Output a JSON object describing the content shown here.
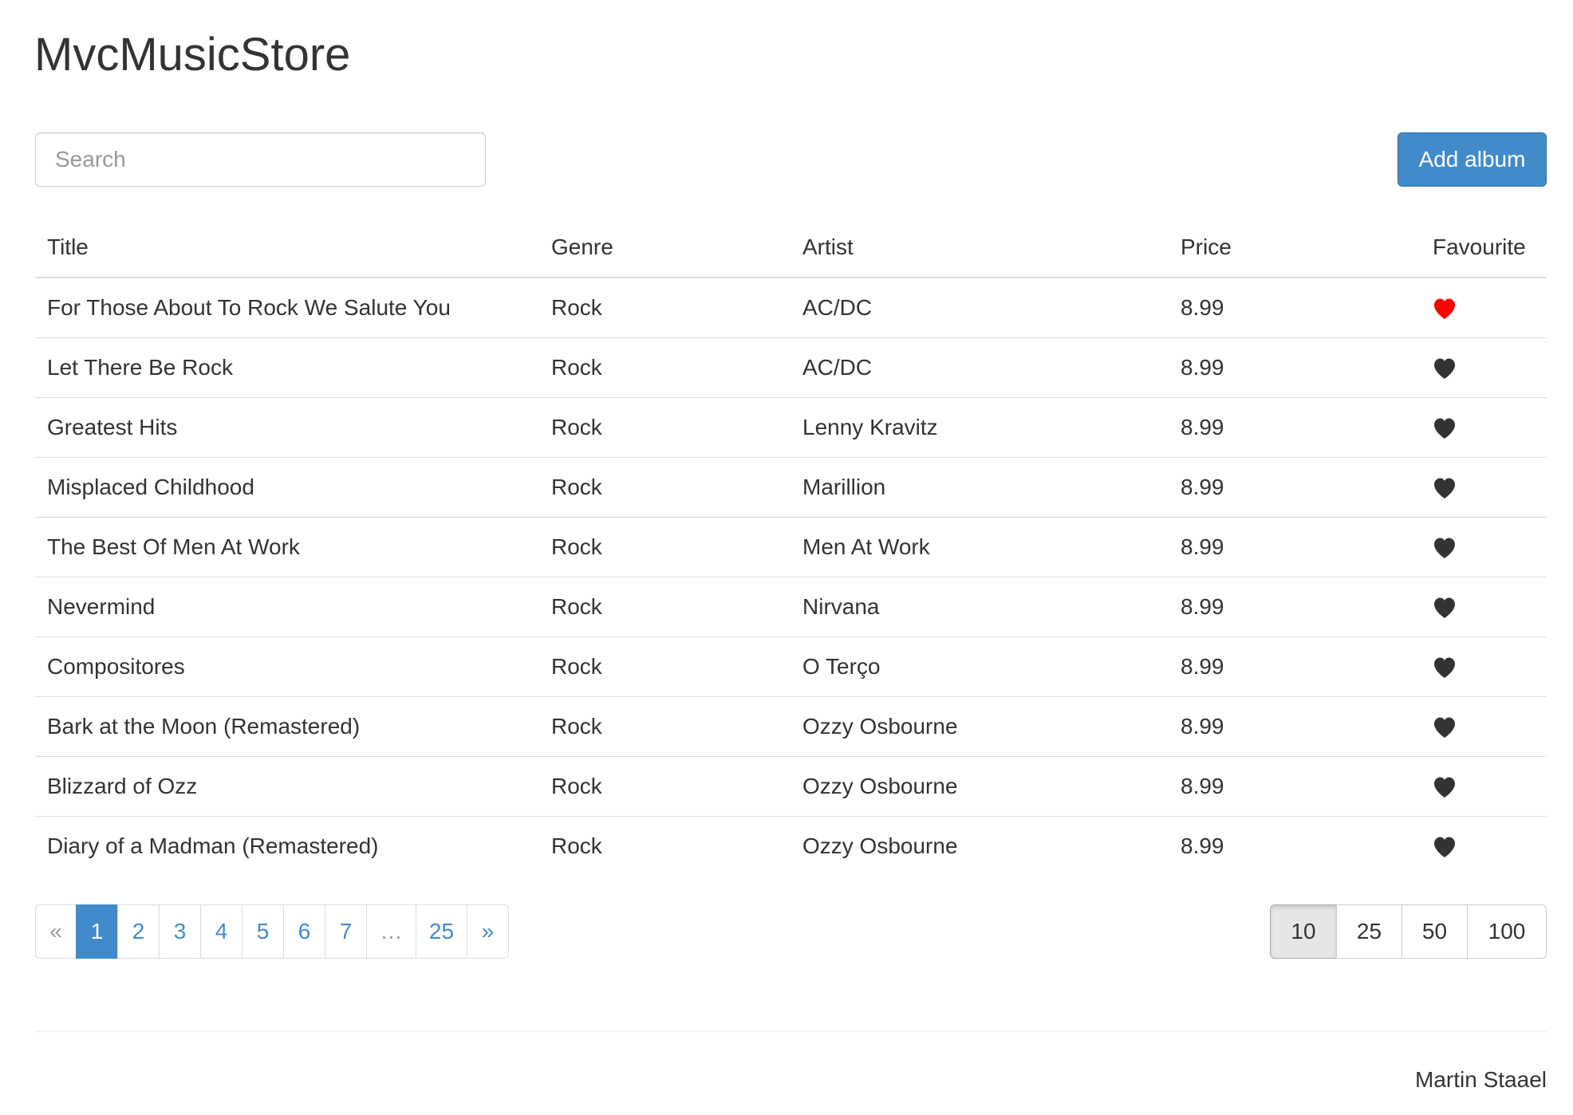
{
  "header": {
    "brand": "MvcMusicStore"
  },
  "toolbar": {
    "search_placeholder": "Search",
    "add_label": "Add album"
  },
  "table": {
    "columns": [
      "Title",
      "Genre",
      "Artist",
      "Price",
      "Favourite"
    ],
    "rows": [
      {
        "title": "For Those About To Rock We Salute You",
        "genre": "Rock",
        "artist": "AC/DC",
        "price": "8.99",
        "favourite": true
      },
      {
        "title": "Let There Be Rock",
        "genre": "Rock",
        "artist": "AC/DC",
        "price": "8.99",
        "favourite": false
      },
      {
        "title": "Greatest Hits",
        "genre": "Rock",
        "artist": "Lenny Kravitz",
        "price": "8.99",
        "favourite": false
      },
      {
        "title": "Misplaced Childhood",
        "genre": "Rock",
        "artist": "Marillion",
        "price": "8.99",
        "favourite": false
      },
      {
        "title": "The Best Of Men At Work",
        "genre": "Rock",
        "artist": "Men At Work",
        "price": "8.99",
        "favourite": false
      },
      {
        "title": "Nevermind",
        "genre": "Rock",
        "artist": "Nirvana",
        "price": "8.99",
        "favourite": false
      },
      {
        "title": "Compositores",
        "genre": "Rock",
        "artist": "O Terço",
        "price": "8.99",
        "favourite": false
      },
      {
        "title": "Bark at the Moon (Remastered)",
        "genre": "Rock",
        "artist": "Ozzy Osbourne",
        "price": "8.99",
        "favourite": false
      },
      {
        "title": "Blizzard of Ozz",
        "genre": "Rock",
        "artist": "Ozzy Osbourne",
        "price": "8.99",
        "favourite": false
      },
      {
        "title": "Diary of a Madman (Remastered)",
        "genre": "Rock",
        "artist": "Ozzy Osbourne",
        "price": "8.99",
        "favourite": false
      }
    ]
  },
  "pagination": {
    "prev": "«",
    "pages": [
      "1",
      "2",
      "3",
      "4",
      "5",
      "6",
      "7",
      "…",
      "25"
    ],
    "next": "»",
    "active_page": "1"
  },
  "page_size": {
    "options": [
      "10",
      "25",
      "50",
      "100"
    ],
    "selected": "10"
  },
  "footer": {
    "text": "Martin Staael"
  },
  "colors": {
    "accent": "#428bca",
    "favourite_on": "#ff0000",
    "favourite_off": "#333333"
  },
  "icons": {
    "favourite": "heart-icon"
  }
}
